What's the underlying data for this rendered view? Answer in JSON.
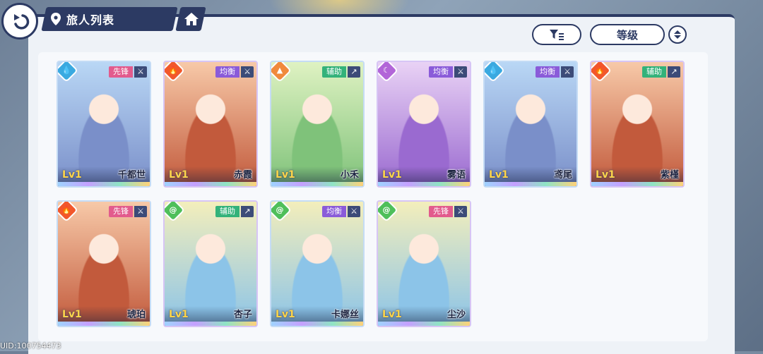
{
  "header": {
    "title": "旅人列表",
    "back_icon": "back-arrow-icon",
    "home_icon": "home-icon",
    "location_icon": "map-pin-icon"
  },
  "toolbar": {
    "filter_icon": "filter-icon",
    "sort_label": "等级",
    "order_icon": "sort-order-icon"
  },
  "colors": {
    "navy": "#2c3a63",
    "water": "#3aa9e0",
    "fire": "#f2572b",
    "earth": "#f08a3c",
    "moon": "#b265d8",
    "wind": "#4fbf5a",
    "role_vanguard": "#e25b8d",
    "role_balance": "#8a5bd9",
    "role_support": "#33b27a",
    "level_text": "#ffd54a",
    "notify_dot": "#ff3b5c"
  },
  "characters": [
    {
      "name": "千都世",
      "level": "Lv1",
      "role": "先锋",
      "element": "water",
      "notify": false
    },
    {
      "name": "赤霞",
      "level": "Lv1",
      "role": "均衡",
      "element": "fire",
      "notify": false
    },
    {
      "name": "小禾",
      "level": "Lv1",
      "role": "辅助",
      "element": "earth",
      "notify": false
    },
    {
      "name": "雾语",
      "level": "Lv1",
      "role": "均衡",
      "element": "moon",
      "notify": false
    },
    {
      "name": "鸢尾",
      "level": "Lv1",
      "role": "均衡",
      "element": "water",
      "notify": true
    },
    {
      "name": "紫槿",
      "level": "Lv1",
      "role": "辅助",
      "element": "fire",
      "notify": false
    },
    {
      "name": "琥珀",
      "level": "Lv1",
      "role": "先锋",
      "element": "fire",
      "notify": true
    },
    {
      "name": "杏子",
      "level": "Lv1",
      "role": "辅助",
      "element": "wind",
      "notify": false
    },
    {
      "name": "卡娜丝",
      "level": "Lv1",
      "role": "均衡",
      "element": "wind",
      "notify": false
    },
    {
      "name": "尘沙",
      "level": "Lv1",
      "role": "先锋",
      "element": "wind",
      "notify": true
    }
  ],
  "footer": {
    "uid": "UID:100754473"
  }
}
